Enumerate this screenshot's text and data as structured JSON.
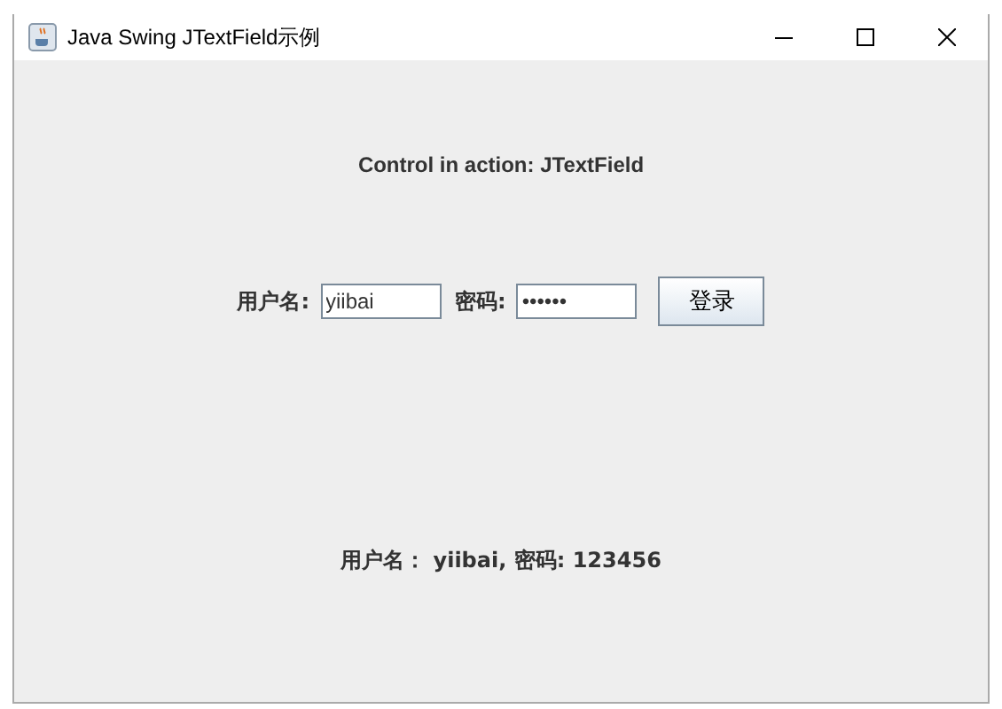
{
  "window": {
    "title": "Java Swing JTextField示例"
  },
  "header": "Control in action: JTextField",
  "form": {
    "username_label": "用户名:",
    "username_value": "yiibai",
    "password_label": "密码:",
    "password_value": "••••••",
    "button": "登录"
  },
  "status": "用户名： yiibai, 密码: 123456"
}
